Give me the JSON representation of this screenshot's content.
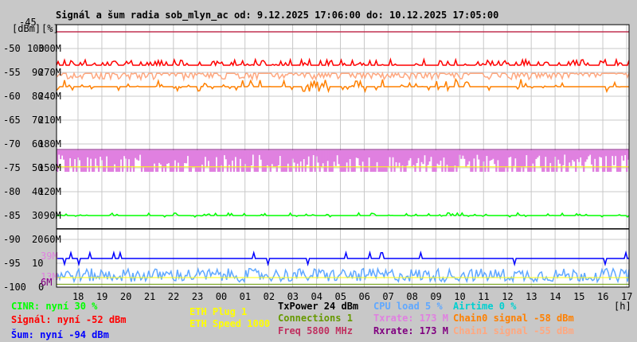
{
  "chart_data": {
    "type": "line",
    "title": "Signál a šum radia sob_mlyn_ac od: 9.12.2025 17:06:00 do: 10.12.2025 17:05:00",
    "ylabel_left": "[dBm]",
    "ylabel_mid": "[%]",
    "xlabel": "[h]",
    "ylim": [
      -100,
      -45
    ],
    "y_ticks": [
      {
        "dbm": "-45",
        "pct": "",
        "m": ""
      },
      {
        "dbm": "-50",
        "pct": "100",
        "m": "300M"
      },
      {
        "dbm": "-55",
        "pct": "90",
        "m": "270M"
      },
      {
        "dbm": "-60",
        "pct": "80",
        "m": "240M"
      },
      {
        "dbm": "-65",
        "pct": "70",
        "m": "210M"
      },
      {
        "dbm": "-70",
        "pct": "60",
        "m": "180M"
      },
      {
        "dbm": "-75",
        "pct": "50",
        "m": "150M"
      },
      {
        "dbm": "-80",
        "pct": "40",
        "m": "120M"
      },
      {
        "dbm": "-85",
        "pct": "30",
        "m": "90M"
      },
      {
        "dbm": "-90",
        "pct": "20",
        "m": "60M"
      },
      {
        "dbm": "-95",
        "pct": "10",
        "m": ""
      },
      {
        "dbm": "-100",
        "pct": "0",
        "m": ""
      }
    ],
    "extra_ticks": [
      {
        "label": "39M",
        "value_m": 39,
        "color": "#e080e0"
      },
      {
        "label": "13M",
        "value_m": 13,
        "color": "#e080e0"
      },
      {
        "label": "6M",
        "value_m": 6,
        "color": "#800080"
      }
    ],
    "x_ticks": [
      "18",
      "19",
      "20",
      "21",
      "22",
      "23",
      "00",
      "01",
      "02",
      "03",
      "04",
      "05",
      "06",
      "07",
      "08",
      "09",
      "10",
      "11",
      "12",
      "13",
      "14",
      "15",
      "16",
      "17"
    ],
    "x_start_hour": 17.1,
    "hlines": [
      {
        "dbm": -46.5,
        "color": "#c03050"
      },
      {
        "dbm": -87.8,
        "color": "#000000"
      }
    ],
    "series": [
      {
        "name": "Signál",
        "color": "#ff0000",
        "base_dbm": -53.5,
        "spread": 1.2,
        "dir": "up"
      },
      {
        "name": "Chain1 signal",
        "color": "#ffa880",
        "base_dbm": -55.2,
        "spread": 1.3,
        "dir": "down"
      },
      {
        "name": "Chain0 signal",
        "color": "#ff8000",
        "base_dbm": -58,
        "spread": 1.3,
        "dir": "mixed"
      },
      {
        "name": "Txrate",
        "color": "#e080e0",
        "base_m": 173,
        "low_m": 146,
        "type": "fill"
      },
      {
        "name": "ETH Speed",
        "color": "#ffff00",
        "base_dbm": -74.8,
        "spread": 0,
        "dir": "none"
      },
      {
        "name": "CINR",
        "color": "#00ff00",
        "base_dbm": -85,
        "spread": 0.5,
        "dir": "mixed"
      },
      {
        "name": "Šum",
        "color": "#0000ff",
        "base_dbm": -94,
        "spread": 1.2,
        "dir": "sparse"
      },
      {
        "name": "CPU load",
        "color": "#60a8ff",
        "base_dbm": -97.5,
        "spread": 1.4,
        "dir": "noise"
      },
      {
        "name": "ETH Plug",
        "color": "#ffff00",
        "base_dbm": -98,
        "spread": 0,
        "dir": "none"
      },
      {
        "name": "Connections",
        "color": "#669900",
        "base_dbm": -99.4,
        "spread": 0,
        "dir": "none"
      }
    ]
  },
  "legend": [
    {
      "text": "CINR: nyní 30 %",
      "color": "#00ff00"
    },
    {
      "text": "Signál: nyní -52 dBm",
      "color": "#ff0000"
    },
    {
      "text": "Šum: nyní -94 dBm",
      "color": "#0000ff"
    },
    {
      "text": "ETH Plug 1",
      "color": "#ffff00"
    },
    {
      "text": "ETH Speed 1000",
      "color": "#ffff00"
    },
    {
      "text": "TxPower 24 dBm",
      "color": "#000000"
    },
    {
      "text": "Connections 1",
      "color": "#669900"
    },
    {
      "text": "Freq 5800 MHz",
      "color": "#c03060"
    },
    {
      "text": "CPU load 5 %",
      "color": "#60a8ff"
    },
    {
      "text": "Txrate: 173 M",
      "color": "#e080e0"
    },
    {
      "text": "Rxrate: 173 M",
      "color": "#800080"
    },
    {
      "text": "Airtime 0 %",
      "color": "#00d0d0"
    },
    {
      "text": "Chain0 signal -58 dBm",
      "color": "#ff8000"
    },
    {
      "text": "Chain1 signal -55 dBm",
      "color": "#ffa880"
    }
  ]
}
